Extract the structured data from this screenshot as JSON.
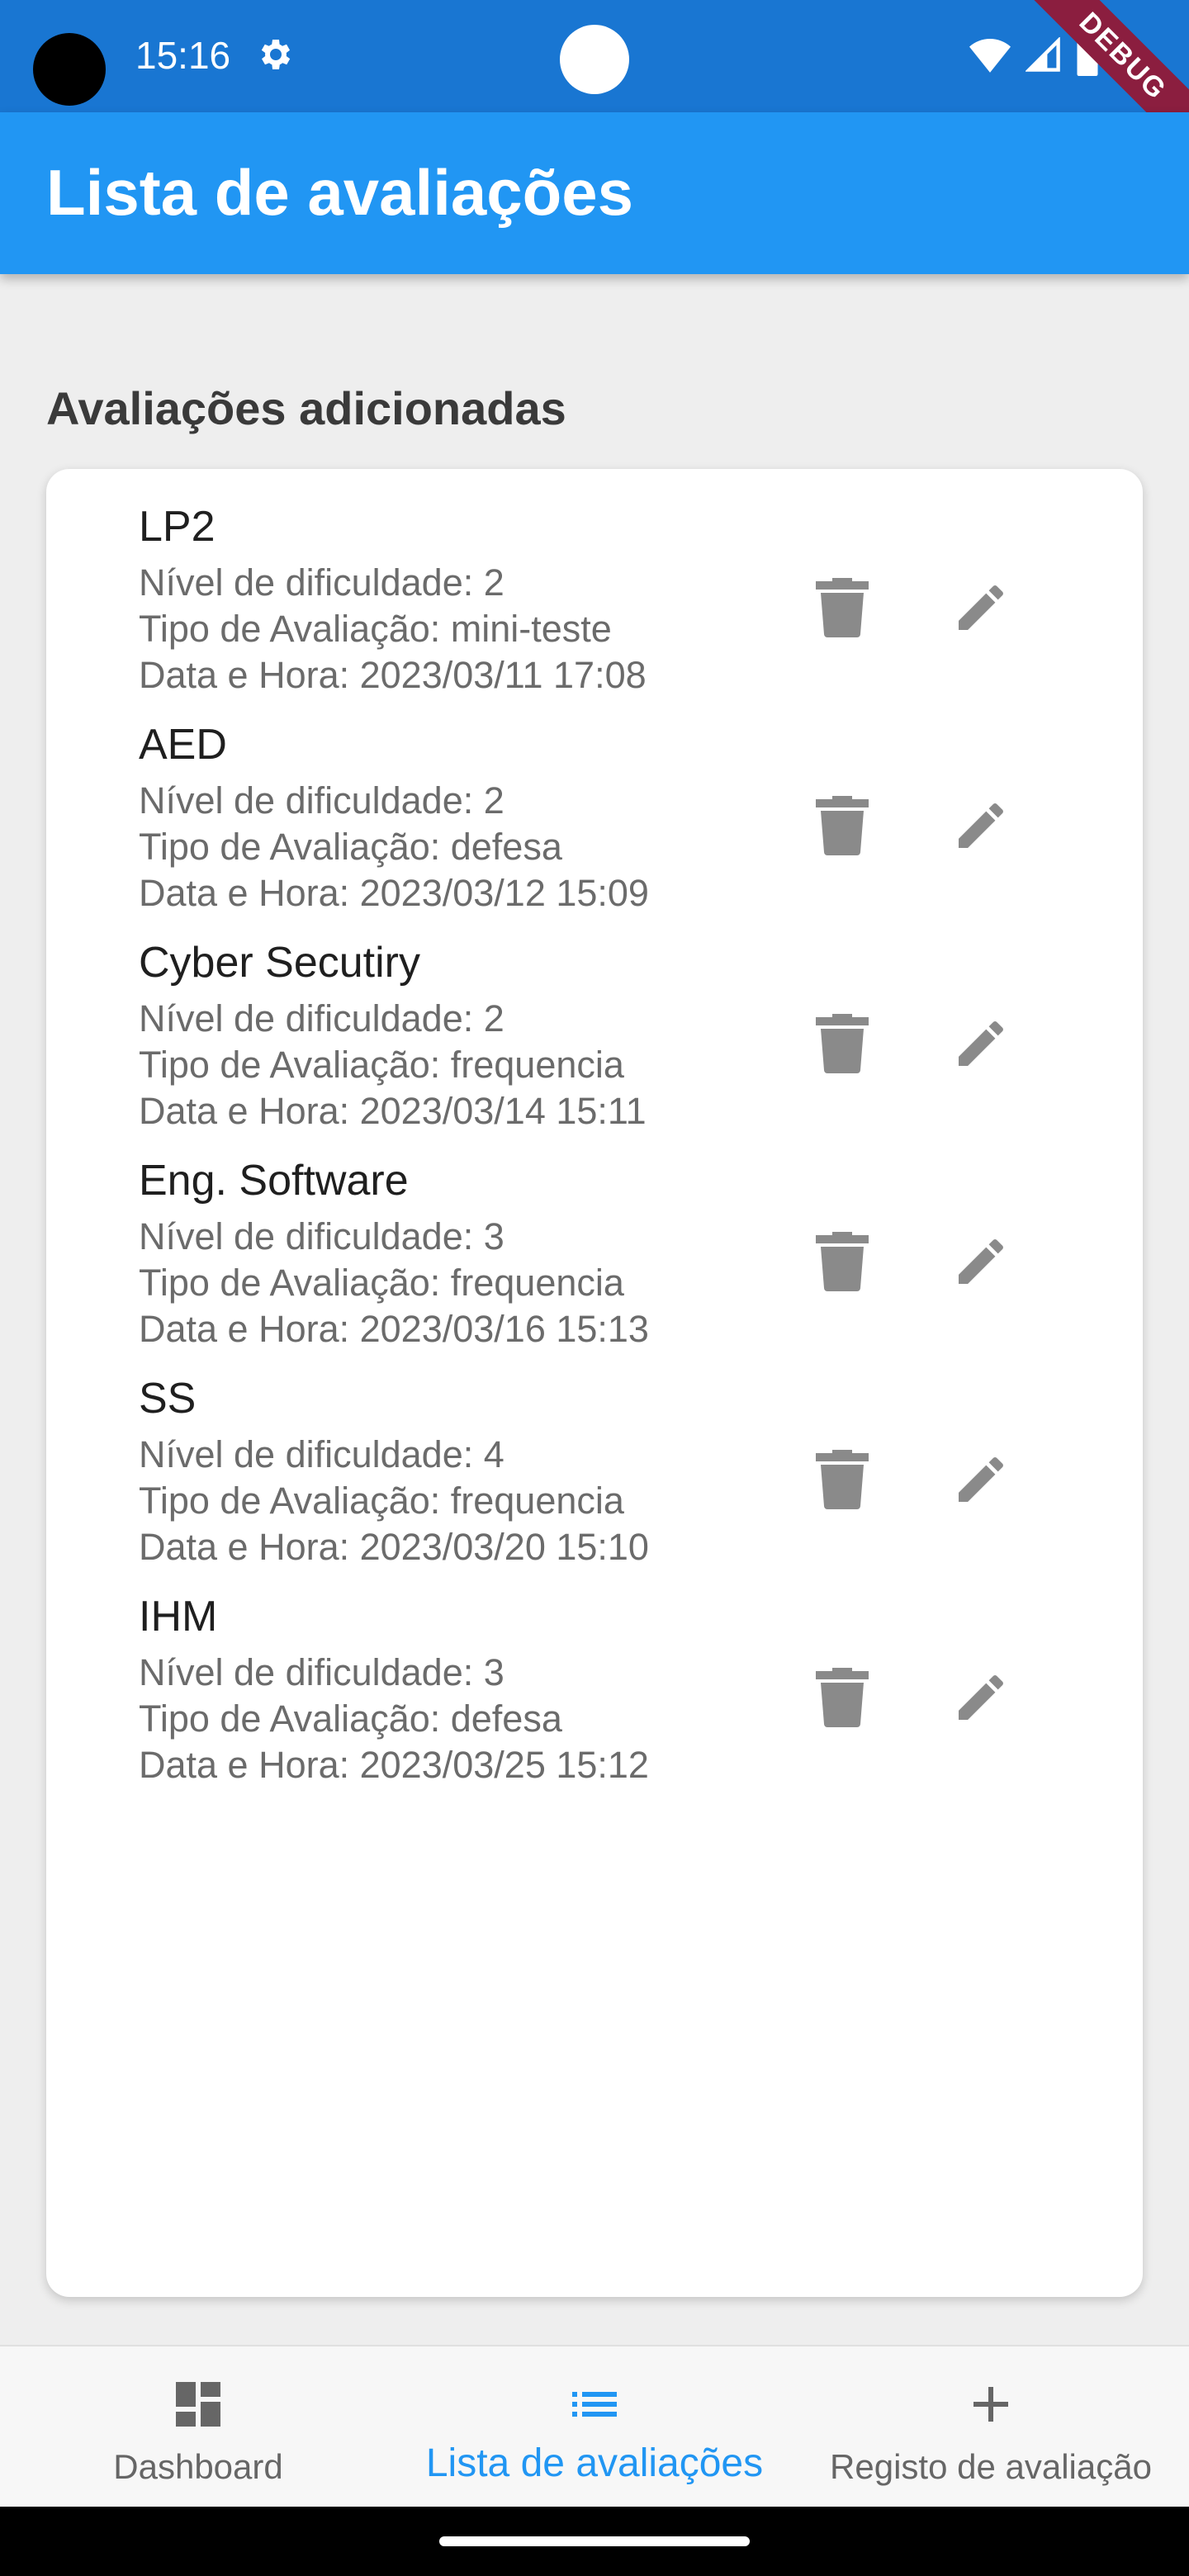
{
  "status_bar": {
    "time": "15:16",
    "debug_label": "DEBUG"
  },
  "app_bar": {
    "title": "Lista de avaliações"
  },
  "section": {
    "title": "Avaliações adicionadas"
  },
  "items": [
    {
      "title": "LP2",
      "difficulty": "Nível de dificuldade: 2",
      "type": "Tipo de Avaliação: mini-teste",
      "datetime": "Data e Hora: 2023/03/11 17:08"
    },
    {
      "title": "AED",
      "difficulty": "Nível de dificuldade: 2",
      "type": "Tipo de Avaliação: defesa",
      "datetime": "Data e Hora: 2023/03/12 15:09"
    },
    {
      "title": "Cyber Secutiry",
      "difficulty": "Nível de dificuldade: 2",
      "type": "Tipo de Avaliação: frequencia",
      "datetime": "Data e Hora: 2023/03/14 15:11"
    },
    {
      "title": "Eng. Software",
      "difficulty": "Nível de dificuldade: 3",
      "type": "Tipo de Avaliação: frequencia",
      "datetime": "Data e Hora: 2023/03/16 15:13"
    },
    {
      "title": "SS",
      "difficulty": "Nível de dificuldade: 4",
      "type": "Tipo de Avaliação: frequencia",
      "datetime": "Data e Hora: 2023/03/20 15:10"
    },
    {
      "title": "IHM",
      "difficulty": "Nível de dificuldade: 3",
      "type": "Tipo de Avaliação: defesa",
      "datetime": "Data e Hora: 2023/03/25 15:12"
    }
  ],
  "bottom_nav": {
    "items": [
      {
        "label": "Dashboard",
        "icon": "dashboard-icon"
      },
      {
        "label": "Lista de avaliações",
        "icon": "list-icon",
        "active": true
      },
      {
        "label": "Registo de avaliação",
        "icon": "add-icon"
      }
    ]
  },
  "colors": {
    "primary": "#2196f3",
    "status_bar": "#1976d2",
    "icon_gray": "#8a8a8a",
    "debug_banner": "#8b1e3f"
  }
}
